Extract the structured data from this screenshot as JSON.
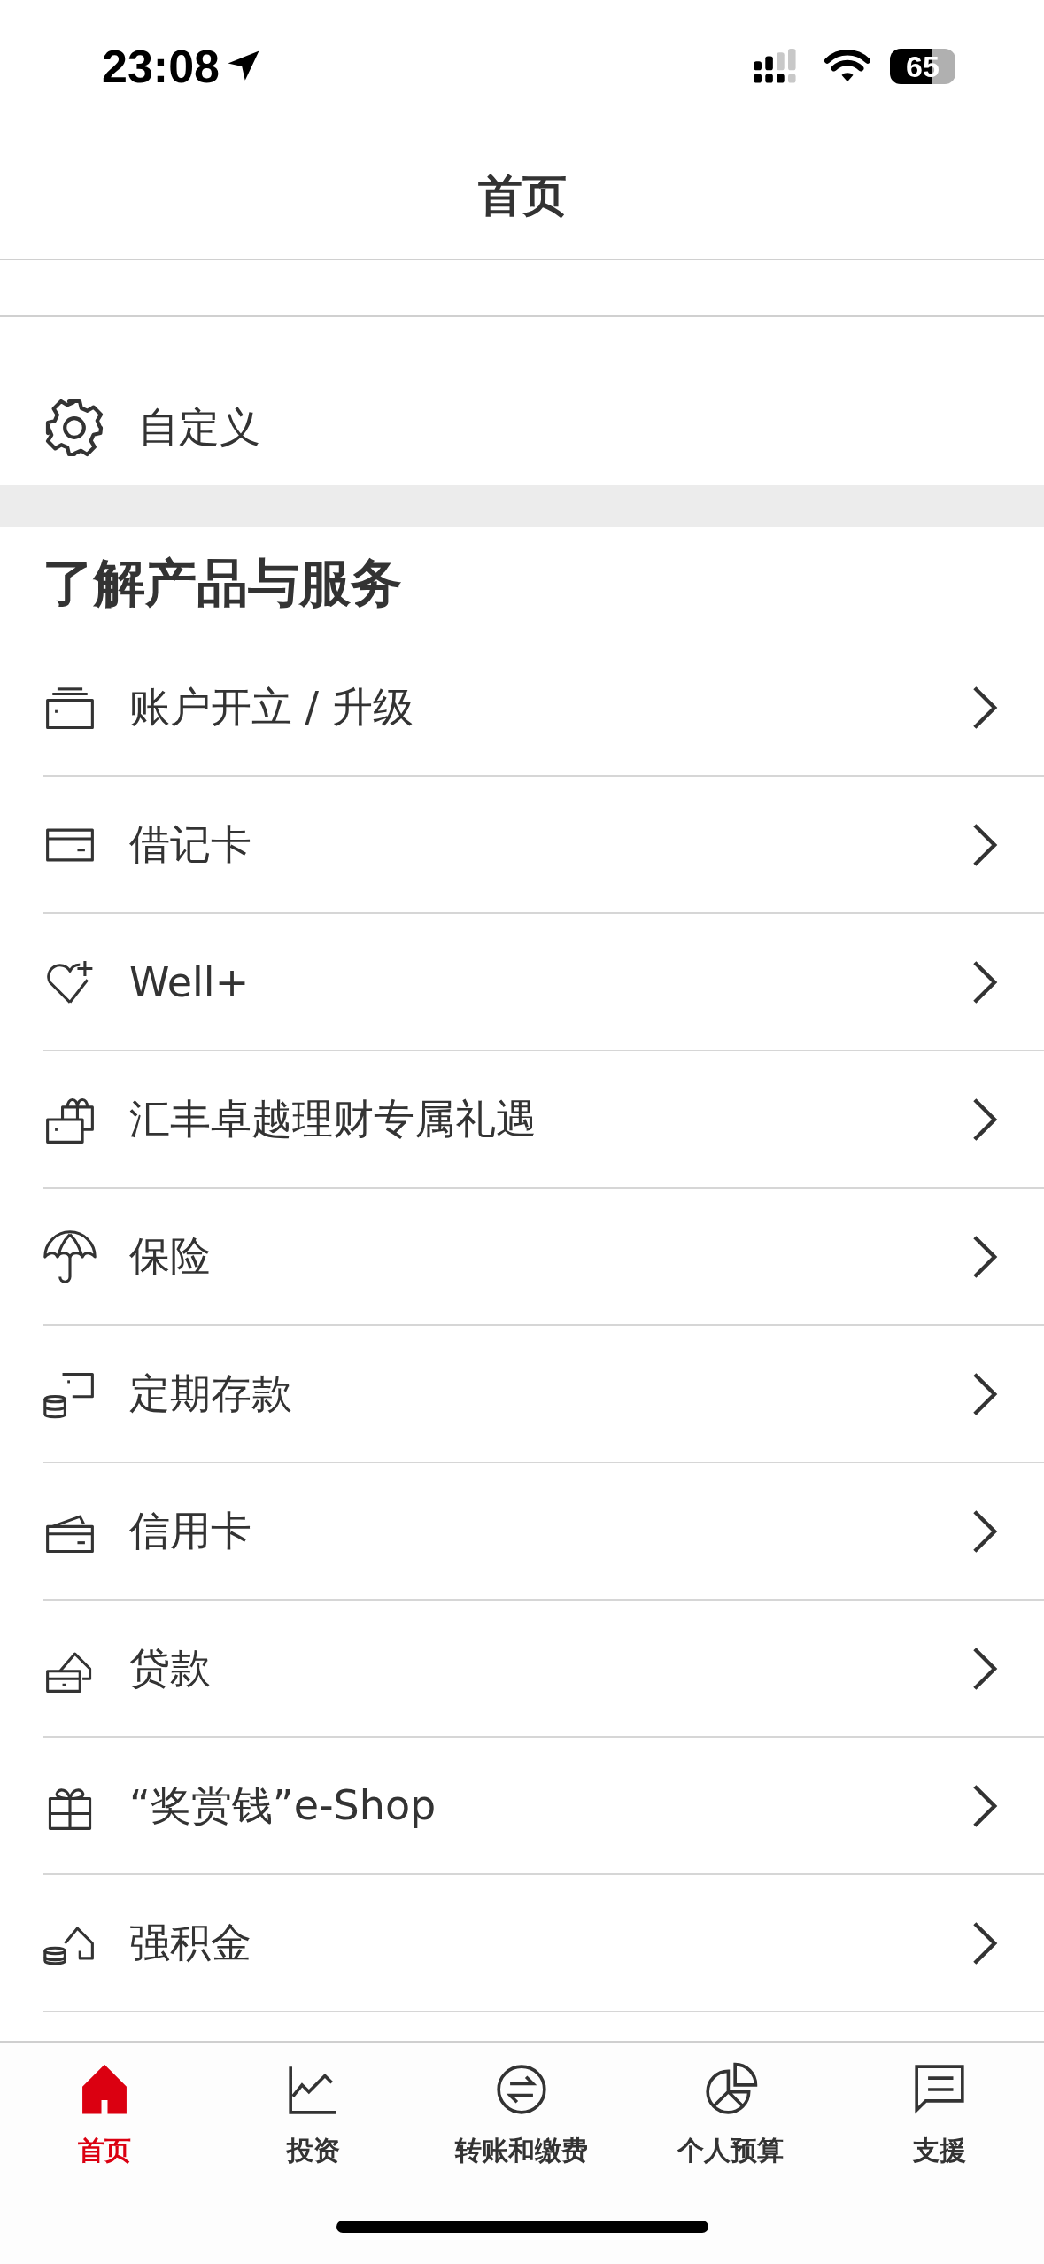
{
  "status_bar": {
    "time": "23:08",
    "battery": "65"
  },
  "title": "首页",
  "customize": {
    "label": "自定义"
  },
  "section": {
    "title": "了解产品与服务",
    "items": [
      {
        "label": "账户开立 / 升级"
      },
      {
        "label": "借记卡"
      },
      {
        "label": "Well+"
      },
      {
        "label": "汇丰卓越理财专属礼遇"
      },
      {
        "label": "保险"
      },
      {
        "label": "定期存款"
      },
      {
        "label": "信用卡"
      },
      {
        "label": "贷款"
      },
      {
        "label": "“奖赏钱”e-Shop"
      },
      {
        "label": "强积金"
      }
    ]
  },
  "tabs": [
    {
      "label": "首页",
      "selected": true
    },
    {
      "label": "投资",
      "selected": false
    },
    {
      "label": "转账和缴费",
      "selected": false
    },
    {
      "label": "个人预算",
      "selected": false
    },
    {
      "label": "支援",
      "selected": false
    }
  ]
}
